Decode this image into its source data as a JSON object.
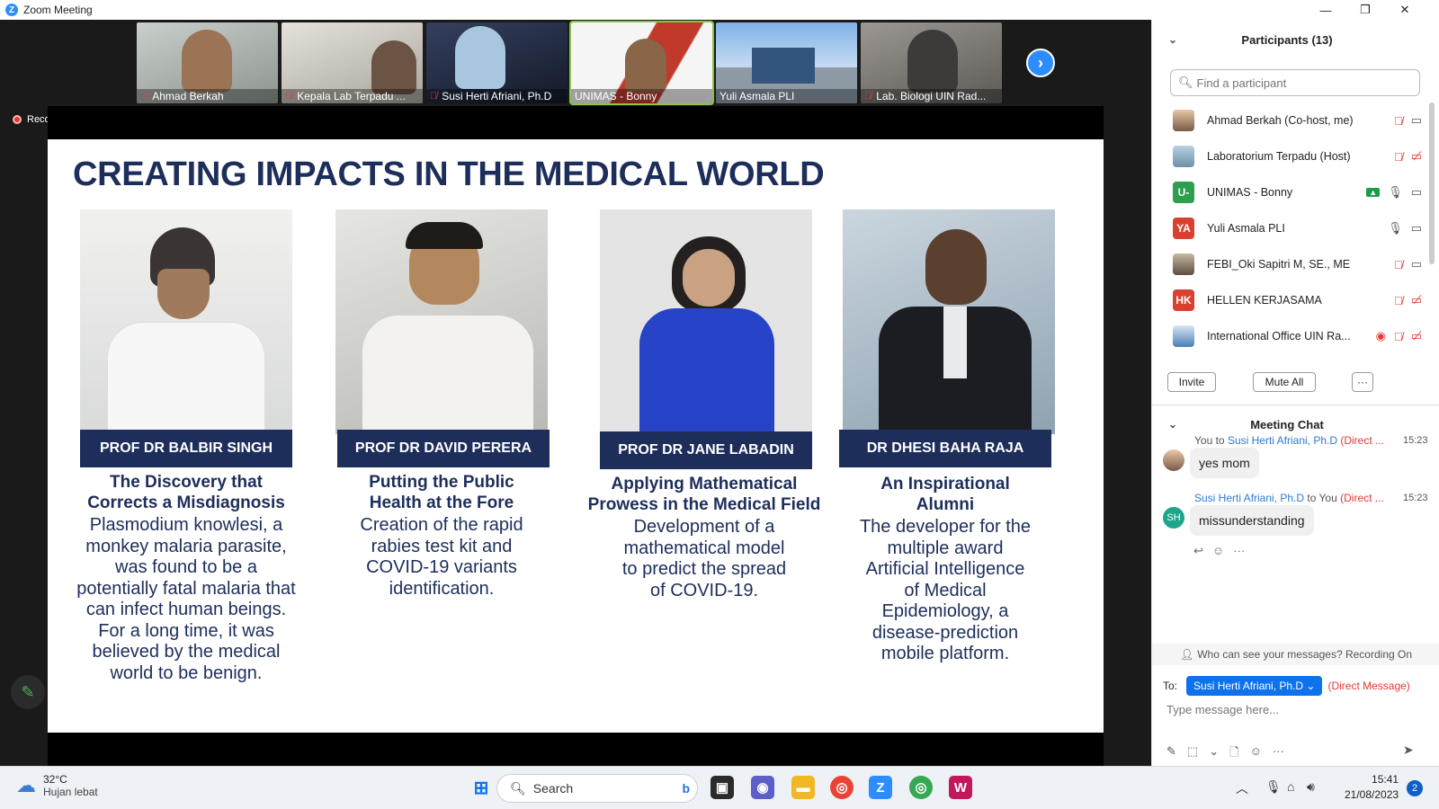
{
  "window": {
    "title": "Zoom Meeting",
    "minimize": "—",
    "maximize": "❐",
    "close": "✕"
  },
  "thumbnails": [
    {
      "name": "Ahmad Berkah",
      "muted": true,
      "bg": "#9aa3a0"
    },
    {
      "name": "Kepala Lab Terpadu ...",
      "muted": true,
      "bg": "#b7b3aa"
    },
    {
      "name": "Susi Herti Afriani, Ph.D",
      "muted": true,
      "bg": "#5f6b8e"
    },
    {
      "name": "UNIMAS - Bonny",
      "muted": false,
      "bg": "#c0392b"
    },
    {
      "name": "Yuli Asmala PLI",
      "muted": false,
      "bg": "#5b8fd1"
    },
    {
      "name": "Lab. Biologi UIN Rad...",
      "muted": true,
      "bg": "#7d7a77"
    }
  ],
  "next_label": "›",
  "recording_label": "Recording",
  "slide": {
    "title": "CREATING IMPACTS IN THE MEDICAL WORLD",
    "cards": [
      {
        "name": "PROF DR BALBIR SINGH",
        "headline_1": "The Discovery that",
        "headline_2": "Corrects a Misdiagnosis",
        "body": [
          "Plasmodium knowlesi, a",
          "monkey malaria parasite,",
          "was found to be a",
          "potentially fatal malaria that",
          "can infect human beings.",
          "For a long time, it was",
          "believed by the medical",
          "world to be benign."
        ]
      },
      {
        "name": "PROF DR DAVID PERERA",
        "headline_1": "Putting the Public",
        "headline_2": "Health at the Fore",
        "body": [
          "Creation of the rapid",
          "rabies test kit and",
          "COVID-19 variants",
          "identification."
        ]
      },
      {
        "name": "PROF DR JANE LABADIN",
        "headline_1": "Applying Mathematical",
        "headline_2": "Prowess in the Medical Field",
        "body": [
          "Development of a",
          "mathematical model",
          "to predict the spread",
          "of COVID-19."
        ]
      },
      {
        "name": "DR DHESI BAHA RAJA",
        "headline_1": "An Inspirational",
        "headline_2": "Alumni",
        "body": [
          "The developer for the",
          "multiple award",
          "Artificial Intelligence",
          "of Medical",
          "Epidemiology, a",
          "disease-prediction",
          "mobile platform."
        ]
      }
    ]
  },
  "participants": {
    "title": "Participants (13)",
    "search_placeholder": "Find a participant",
    "list": [
      {
        "name": "Ahmad Berkah (Co-host, me)",
        "avatar": "",
        "color": "#7a5a48",
        "mic": "muted",
        "video": "on"
      },
      {
        "name": "Laboratorium Terpadu (Host)",
        "avatar": "",
        "color": "#6d8fa8",
        "mic": "muted",
        "video": "off"
      },
      {
        "name": "UNIMAS - Bonny",
        "avatar": "U-",
        "color": "#2e9e4f",
        "mic": "on",
        "video": "on"
      },
      {
        "name": "Yuli Asmala PLI",
        "avatar": "YA",
        "color": "#d9412e",
        "mic": "on",
        "video": "on"
      },
      {
        "name": "FEBI_Oki Sapitri M, SE., ME",
        "avatar": "",
        "color": "#8a7a66",
        "mic": "muted",
        "video": "on"
      },
      {
        "name": "HELLEN KERJASAMA",
        "avatar": "HK",
        "color": "#d9412e",
        "mic": "muted",
        "video": "off"
      },
      {
        "name": "International Office UIN Ra...",
        "avatar": "",
        "color": "#4a7fb5",
        "mic": "muted",
        "video": "off"
      }
    ],
    "invite_label": "Invite",
    "mute_all_label": "Mute All",
    "more_label": "···"
  },
  "chat": {
    "title": "Meeting Chat",
    "messages": [
      {
        "sender": "You",
        "to_word": "to",
        "recipient": "Susi Herti Afriani, Ph.D",
        "dm": "(Direct ...",
        "time": "15:23",
        "text": "yes mom",
        "avatar": ""
      },
      {
        "sender": "Susi Herti Afriani, Ph.D",
        "to_word": "to",
        "recipient": "You",
        "dm": "(Direct ...",
        "time": "15:23",
        "text": "missunderstanding",
        "avatar": "SH"
      }
    ],
    "notice": "Who can see your messages? Recording On",
    "to_label": "To:",
    "to_target": "Susi Herti Afriani, Ph.D",
    "to_dm": "(Direct Message)",
    "input_placeholder": "Type message here..."
  },
  "taskbar": {
    "temp": "32°C",
    "weather": "Hujan lebat",
    "search_label": "Search",
    "time": "15:41",
    "date": "21/08/2023",
    "notifications": "2"
  },
  "colors": {
    "zoom_blue": "#2d8cff",
    "slide_navy": "#1d2e5b",
    "mute_red": "#e53935"
  }
}
